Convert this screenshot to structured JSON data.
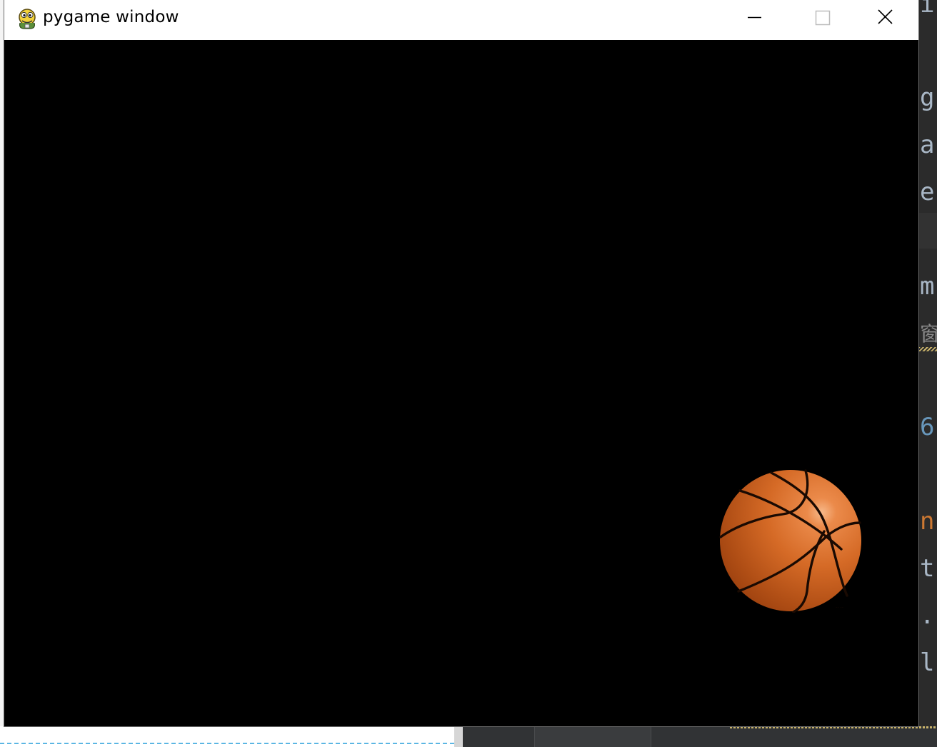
{
  "window": {
    "title": "pygame window",
    "icon": "pygame-snake-icon",
    "controls": {
      "minimize_icon": "minimize-icon",
      "maximize_icon": "maximize-icon",
      "close_icon": "close-icon"
    }
  },
  "game": {
    "background_color": "#000000",
    "sprites": [
      {
        "type": "basketball",
        "icon": "basketball-icon"
      }
    ]
  },
  "background_editor": {
    "visible_chars": [
      "i",
      "g",
      "a",
      "e",
      "m",
      "窗",
      "6",
      "n",
      "t",
      ".",
      "l"
    ]
  }
}
